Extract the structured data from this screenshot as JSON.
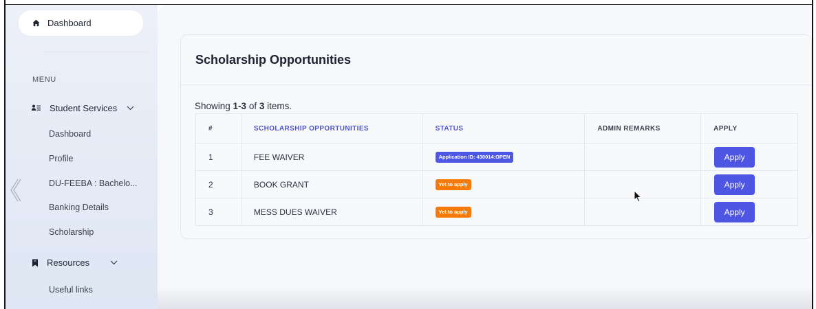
{
  "sidebar": {
    "top_item": {
      "label": "Dashboard",
      "icon": "home-icon"
    },
    "menu_heading": "MENU",
    "student_services": {
      "label": "Student Services",
      "icon": "users-list-icon",
      "items": [
        {
          "label": "Dashboard"
        },
        {
          "label": "Profile"
        },
        {
          "label": "DU-FEEBA : Bachelo..."
        },
        {
          "label": "Banking Details"
        },
        {
          "label": "Scholarship"
        }
      ]
    },
    "resources": {
      "label": "Resources",
      "icon": "bookmark-icon",
      "items": [
        {
          "label": "Useful links"
        }
      ]
    },
    "collapse_icon": "chevron-left-icon"
  },
  "main": {
    "card_title": "Scholarship Opportunities",
    "summary": {
      "prefix": "Showing ",
      "range": "1-3",
      "middle": " of ",
      "total": "3",
      "suffix": " items."
    },
    "table": {
      "headers": [
        "#",
        "SCHOLARSHIP OPPORTUNITIES",
        "STATUS",
        "ADMIN REMARKS",
        "APPLY"
      ],
      "rows": [
        {
          "index": "1",
          "name": "FEE WAIVER",
          "status": "Application ID: 430014:OPEN",
          "status_color": "#4e56e6",
          "remarks": "",
          "apply": "Apply"
        },
        {
          "index": "2",
          "name": "BOOK GRANT",
          "status": "Yet to apply",
          "status_color": "#f47a0a",
          "remarks": "",
          "apply": "Apply"
        },
        {
          "index": "3",
          "name": "MESS DUES WAIVER",
          "status": "Yet to apply",
          "status_color": "#f47a0a",
          "remarks": "",
          "apply": "Apply"
        }
      ]
    }
  },
  "colors": {
    "accent": "#4f55e3",
    "header_link": "#4f55c7",
    "badge_open": "#4e56e6",
    "badge_pending": "#f47a0a"
  }
}
